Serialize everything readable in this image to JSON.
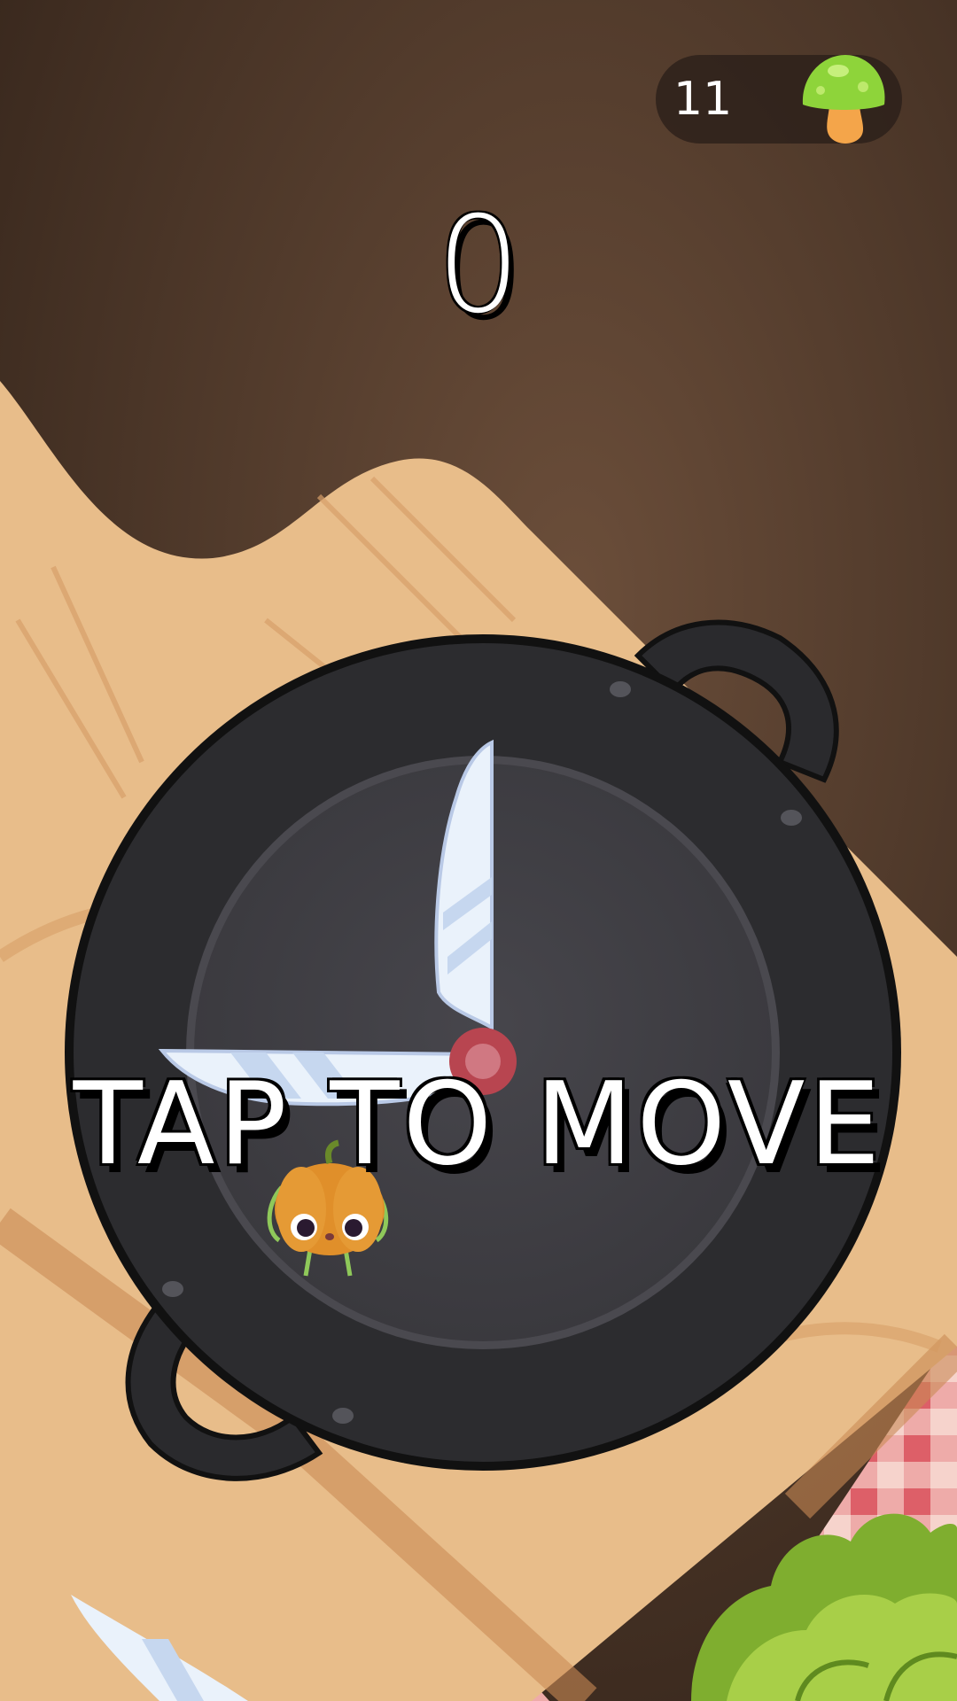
{
  "hud": {
    "currency_count": "11",
    "currency_icon": "mushroom-icon",
    "score": "0"
  },
  "prompt": {
    "text": "TAP TO MOVE"
  },
  "colors": {
    "background_top": "#3b2a1f",
    "background_glow": "#6b4e3a",
    "cutting_board": "#e8bd8a",
    "cutting_board_shadow": "#c98a55",
    "tablecloth_red": "#e06f76",
    "tablecloth_light": "#f6d3cc",
    "pan_rim": "#2b2b2e",
    "pan_inner": "#444349",
    "knife_blade": "#eaf2fb",
    "hub": "#c4525c",
    "mushroom_cap": "#8ed43a",
    "mushroom_stem": "#f4a54a"
  },
  "characters": {
    "player": "pumpkin-character",
    "hazard": "rotating-knives",
    "decor": [
      "lettuce-leaves",
      "table-knife"
    ]
  }
}
